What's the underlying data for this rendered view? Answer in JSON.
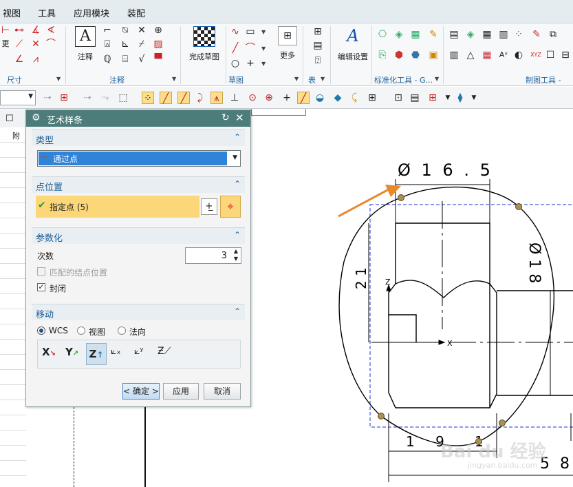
{
  "menubar": {
    "items": [
      "视图",
      "工具",
      "应用模块",
      "装配"
    ]
  },
  "ribbon": {
    "groups": {
      "dimension_label": "尺寸",
      "annotation_label": "注释",
      "sketch_label": "草图",
      "table_label": "表",
      "standard_tools_label": "标准化工具 - G...",
      "drafting_tools_label": "制图工具 -"
    },
    "buttons": {
      "annotation": "注释",
      "finish_sketch": "完成草图",
      "more": "更多",
      "edit_settings": "编辑设置",
      "side_left_char": "更"
    }
  },
  "left_panel": {
    "col_char": "附"
  },
  "dialog": {
    "title": "艺术样条",
    "type_section": {
      "title": "类型",
      "selected": "通过点"
    },
    "point_section": {
      "title": "点位置",
      "specify_label": "指定点 (5)"
    },
    "param_section": {
      "title": "参数化",
      "degree_label": "次数",
      "degree_value": "3",
      "match_knots_label": "匹配的结点位置",
      "match_knots_checked": false,
      "closed_label": "封闭",
      "closed_checked": true
    },
    "move_section": {
      "title": "移动",
      "radio_wcs": "WCS",
      "radio_view": "视图",
      "radio_normal": "法向",
      "selected": "WCS"
    },
    "buttons": {
      "ok": "< 确定 >",
      "apply": "应用",
      "cancel": "取消"
    }
  },
  "drawing": {
    "dim_diameter_16": "Ø 1 6 . 5",
    "dim_diameter_18": "Ø 1 8",
    "dim_21": "2 1",
    "dim_19": "1 9",
    "dim_1": "1",
    "dim_58": "5 8",
    "axis_z": "Z",
    "axis_x": "X"
  },
  "watermark": {
    "brand": "Bai du 经验",
    "url": "jingyan.baidu.com"
  },
  "colors": {
    "dialog_title_bg": "#4d7d7a",
    "selected_blue": "#2f83d8",
    "highlight_yellow": "#fcd77a",
    "spline_point": "#a89155",
    "dash_blue": "#1a2fd0",
    "arrow_orange": "#e8892c"
  }
}
